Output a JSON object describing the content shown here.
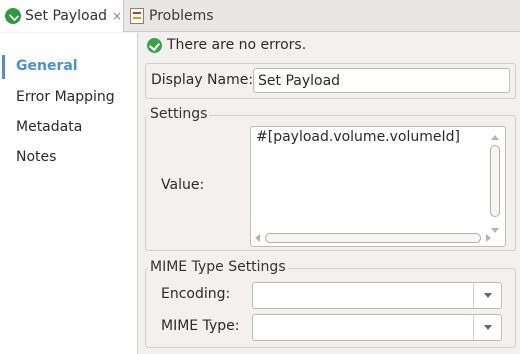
{
  "tabs": {
    "active_label": "Set Payload",
    "inactive_label": "Problems",
    "close_glyph": "×"
  },
  "nav": {
    "items": [
      {
        "label": "General",
        "active": true
      },
      {
        "label": "Error Mapping",
        "active": false
      },
      {
        "label": "Metadata",
        "active": false
      },
      {
        "label": "Notes",
        "active": false
      }
    ]
  },
  "status": {
    "message": "There are no errors."
  },
  "display_name": {
    "label": "Display Name:",
    "value": "Set Payload"
  },
  "settings": {
    "title": "Settings",
    "value_label": "Value:",
    "value_text": "#[payload.volume.volumeId]"
  },
  "mime": {
    "title": "MIME Type Settings",
    "encoding_label": "Encoding:",
    "encoding_value": "",
    "mime_label": "MIME Type:",
    "mime_value": ""
  },
  "colors": {
    "accent": "#4a8fd6",
    "ok_green": "#3aa34a",
    "background": "#f2f1f0"
  }
}
